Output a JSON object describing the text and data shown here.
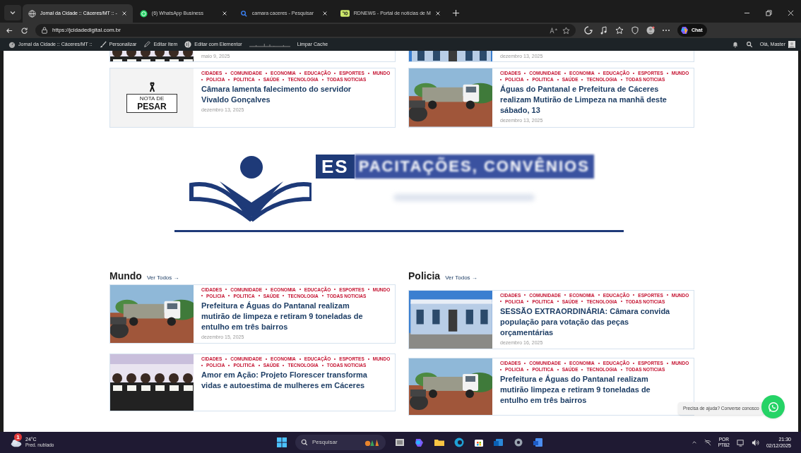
{
  "tabs": [
    {
      "title": "Jornal da Cidade :: Cáceres/MT :: -",
      "selected": true
    },
    {
      "title": "(6) WhatsApp Business",
      "selected": false
    },
    {
      "title": "camara caceres - Pesquisar",
      "selected": false
    },
    {
      "title": "RDNEWS - Portal de notícias de M",
      "selected": false
    }
  ],
  "address_bar": {
    "url": "https://jcidadedigital.com.br"
  },
  "toolbar": {
    "chat_label": "Chat"
  },
  "admin_bar": {
    "items": [
      {
        "label": "Jornal da Cidade :: Cáceres/MT ::"
      },
      {
        "label": "Personalizar"
      },
      {
        "label": "Editar Item"
      },
      {
        "label": "Editar com Elementor"
      },
      {
        "label": "Limpar Cache"
      }
    ],
    "greeting": "Olá, Master"
  },
  "top_strip": [
    {
      "date": "maio 9, 2025"
    },
    {
      "date": "dezembro 13, 2025"
    }
  ],
  "first_row": [
    {
      "kind": "notice",
      "nota_lines": [
        "NOTA DE",
        "PESAR"
      ],
      "categories": [
        "CIDADES",
        "COMUNIDADE",
        "ECONOMIA",
        "EDUCAÇÃO",
        "ESPORTES",
        "MUNDO",
        "POLICIA",
        "POLITICA",
        "SAÚDE",
        "TECNOLOGIA",
        "TODAS NOTICIAS"
      ],
      "title": "Câmara lamenta falecimento do servidor Vivaldo Gonçalves",
      "date": "dezembro 13, 2025"
    },
    {
      "kind": "picture",
      "categories": [
        "CIDADES",
        "COMUNIDADE",
        "ECONOMIA",
        "EDUCAÇÃO",
        "ESPORTES",
        "MUNDO",
        "POLICIA",
        "POLITICA",
        "SAÚDE",
        "TECNOLOGIA",
        "TODAS NOTICIAS"
      ],
      "title": "Águas do Pantanal e Prefeitura de Cáceres realizam Mutirão de Limpeza na manhã deste sábado, 13",
      "date": "dezembro 13, 2025"
    }
  ],
  "banner": {
    "clear_text": "ES",
    "blurred_text": "PACITAÇÕES, CONVÊNIOS"
  },
  "sections": [
    {
      "heading": "Mundo",
      "link": "Ver Todos →",
      "cards": [
        {
          "categories": [
            "CIDADES",
            "COMUNIDADE",
            "ECONOMIA",
            "EDUCAÇÃO",
            "ESPORTES",
            "MUNDO",
            "POLICIA",
            "POLITICA",
            "SAÚDE",
            "TECNOLOGIA",
            "TODAS NOTICIAS"
          ],
          "title": "Prefeitura e Águas do Pantanal realizam mutirão de limpeza e retiram 9 toneladas de entulho em três bairros",
          "date": "dezembro 15, 2025"
        },
        {
          "categories": [
            "CIDADES",
            "COMUNIDADE",
            "ECONOMIA",
            "EDUCAÇÃO",
            "ESPORTES",
            "MUNDO",
            "POLICIA",
            "POLITICA",
            "SAÚDE",
            "TECNOLOGIA",
            "TODAS NOTICIAS"
          ],
          "title": "Amor em Ação: Projeto Florescer transforma vidas e autoestima de mulheres em Cáceres"
        }
      ]
    },
    {
      "heading": "Policia",
      "link": "Ver Todos →",
      "cards": [
        {
          "categories": [
            "CIDADES",
            "COMUNIDADE",
            "ECONOMIA",
            "EDUCAÇÃO",
            "ESPORTES",
            "MUNDO",
            "POLICIA",
            "POLITICA",
            "SAÚDE",
            "TECNOLOGIA",
            "TODAS NOTICIAS"
          ],
          "title": "SESSÃO EXTRAORDINÁRIA: Câmara convida população para votação das peças orçamentárias",
          "date": "dezembro 16, 2025"
        },
        {
          "categories": [
            "CIDADES",
            "COMUNIDADE",
            "ECONOMIA",
            "EDUCAÇÃO",
            "ESPORTES",
            "MUNDO",
            "POLICIA",
            "POLITICA",
            "SAÚDE",
            "TECNOLOGIA",
            "TODAS NOTICIAS"
          ],
          "title": "Prefeitura e Águas do Pantanal realizam mutirão limpeza e retiram 9 toneladas de entulho em três bairros"
        }
      ]
    }
  ],
  "chat_widget": {
    "bubble": "Precisa de ajuda? Converse conosco"
  },
  "taskbar": {
    "weather": {
      "temp": "24°C",
      "desc": "Pred. nublado",
      "badge": "1"
    },
    "search_placeholder": "Pesquisar",
    "language": "POR",
    "layout": "PTB2",
    "time": "21:30",
    "date": "02/12/2025"
  }
}
